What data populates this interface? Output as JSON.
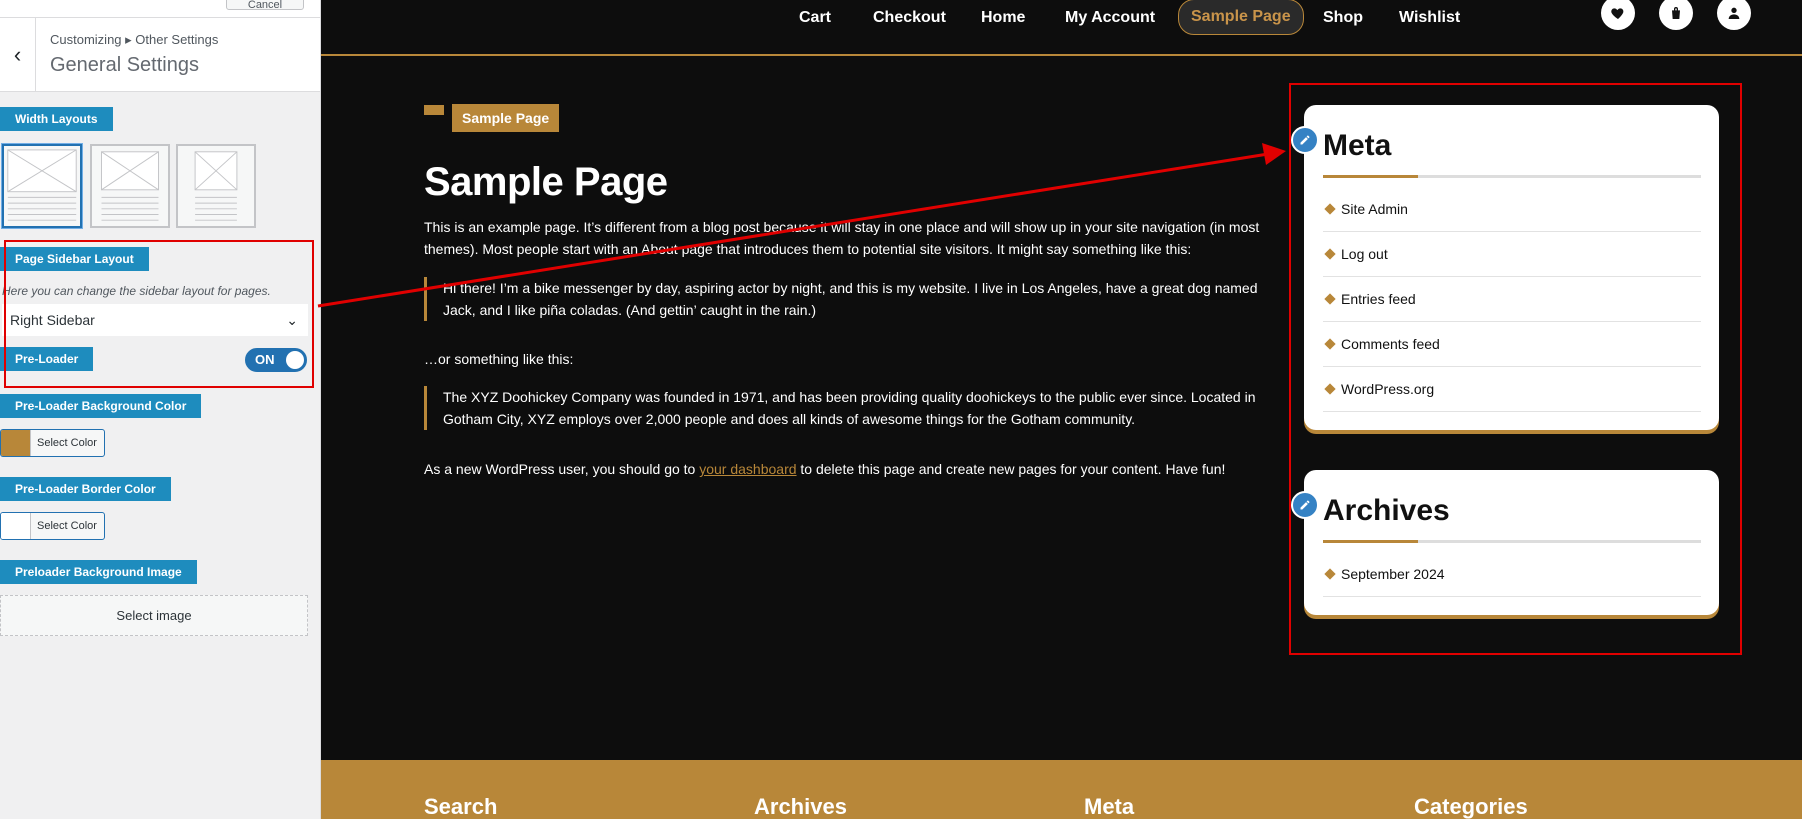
{
  "customizer": {
    "cancel_label": "Cancel",
    "back_label": "‹",
    "breadcrumb": "Customizing ▸ Other Settings",
    "section_title": "General Settings",
    "width_layouts_label": "Width Layouts",
    "sidebar_layout_label": "Page Sidebar Layout",
    "sidebar_layout_help": "Here you can change the sidebar layout for pages.",
    "sidebar_layout_value": "Right Sidebar",
    "preloader_label": "Pre-Loader",
    "preloader_toggle": "ON",
    "preloader_bg_label": "Pre-Loader Background Color",
    "preloader_bg_button": "Select Color",
    "preloader_bg_color": "#b88739",
    "preloader_border_label": "Pre-Loader Border Color",
    "preloader_border_button": "Select Color",
    "preloader_border_color": "#ffffff",
    "preloader_image_label": "Preloader Background Image",
    "select_image_label": "Select image"
  },
  "nav": {
    "items": [
      "Cart",
      "Checkout",
      "Home",
      "My Account",
      "Sample Page",
      "Shop",
      "Wishlist"
    ],
    "active": "Sample Page",
    "icons": [
      "heart-icon",
      "bag-icon",
      "user-icon"
    ]
  },
  "page": {
    "breadcrumb_badge": "Sample Page",
    "title": "Sample Page",
    "intro": "This is an example page. It’s different from a blog post because it will stay in one place and will show up in your site navigation (in most themes). Most people start with an About page that introduces them to potential site visitors. It might say something like this:",
    "quote1": "Hi there! I’m a bike messenger by day, aspiring actor by night, and this is my website. I live in Los Angeles, have a great dog named Jack, and I like piña coladas. (And gettin’ caught in the rain.)",
    "or_text": "…or something like this:",
    "quote2": "The XYZ Doohickey Company was founded in 1971, and has been providing quality doohickeys to the public ever since. Located in Gotham City, XYZ employs over 2,000 people and does all kinds of awesome things for the Gotham community.",
    "outro_before": "As a new WordPress user, you should go to ",
    "outro_link": "your dashboard",
    "outro_after": " to delete this page and create new pages for your content. Have fun!"
  },
  "sidebar": {
    "meta_title": "Meta",
    "meta_items": [
      "Site Admin",
      "Log out",
      "Entries feed",
      "Comments feed",
      "WordPress.org"
    ],
    "archives_title": "Archives",
    "archives_items": [
      "September 2024"
    ]
  },
  "footer": {
    "headings": [
      "Search",
      "Archives",
      "Meta",
      "Categories"
    ]
  },
  "colors": {
    "accent": "#b88739",
    "customizer_label": "#1e8cbe",
    "annotation": "#e00000"
  }
}
